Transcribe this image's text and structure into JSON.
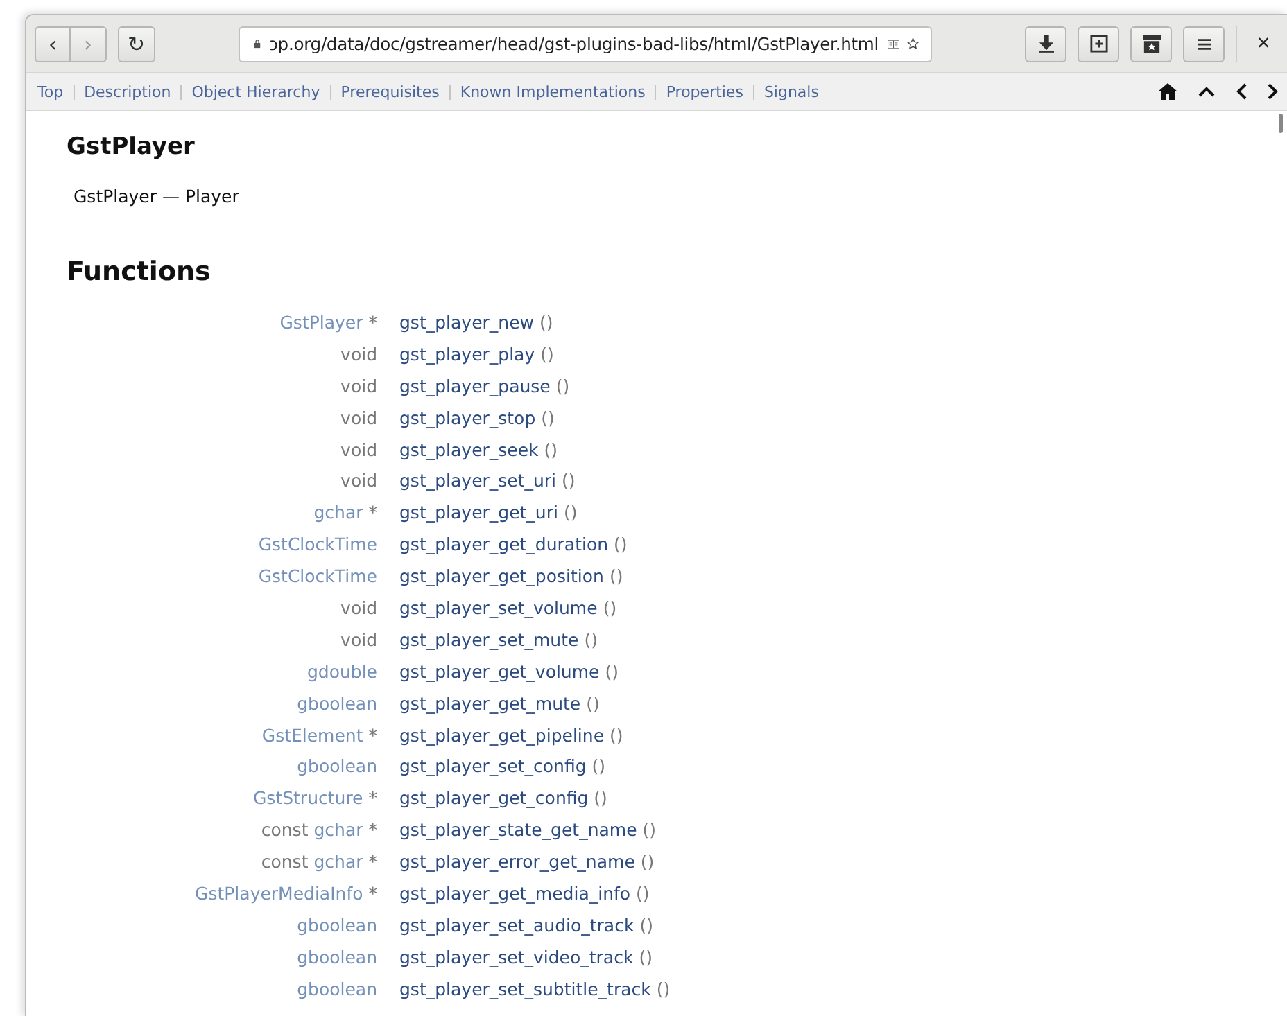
{
  "toolbar": {
    "back": "‹",
    "forward": "›",
    "reload": "↻",
    "url": "ɔp.org/data/doc/gstreamer/head/gst-plugins-bad-libs/html/GstPlayer.html",
    "close": "×"
  },
  "nav_links": [
    {
      "label": "Top"
    },
    {
      "label": "Description"
    },
    {
      "label": "Object Hierarchy"
    },
    {
      "label": "Prerequisites"
    },
    {
      "label": "Known Implementations"
    },
    {
      "label": "Properties"
    },
    {
      "label": "Signals"
    }
  ],
  "title": "GstPlayer",
  "subtitle": "GstPlayer — Player",
  "section": "Functions",
  "functions": [
    {
      "type": "GstPlayer",
      "linked": true,
      "star": "*",
      "name": "gst_player_new",
      "parens": "()"
    },
    {
      "type": "void",
      "linked": false,
      "name": "gst_player_play",
      "parens": "()"
    },
    {
      "type": "void",
      "linked": false,
      "name": "gst_player_pause",
      "parens": "()"
    },
    {
      "type": "void",
      "linked": false,
      "name": "gst_player_stop",
      "parens": "()"
    },
    {
      "type": "void",
      "linked": false,
      "name": "gst_player_seek",
      "parens": "()"
    },
    {
      "type": "void",
      "linked": false,
      "name": "gst_player_set_uri",
      "parens": "()"
    },
    {
      "type": "gchar",
      "linked": true,
      "star": "*",
      "name": "gst_player_get_uri",
      "parens": "()"
    },
    {
      "type": "GstClockTime",
      "linked": true,
      "name": "gst_player_get_duration",
      "parens": "()"
    },
    {
      "type": "GstClockTime",
      "linked": true,
      "name": "gst_player_get_position",
      "parens": "()"
    },
    {
      "type": "void",
      "linked": false,
      "name": "gst_player_set_volume",
      "parens": "()"
    },
    {
      "type": "void",
      "linked": false,
      "name": "gst_player_set_mute",
      "parens": "()"
    },
    {
      "type": "gdouble",
      "linked": true,
      "name": "gst_player_get_volume",
      "parens": "()"
    },
    {
      "type": "gboolean",
      "linked": true,
      "name": "gst_player_get_mute",
      "parens": "()"
    },
    {
      "type": "GstElement",
      "linked": true,
      "star": "*",
      "name": "gst_player_get_pipeline",
      "parens": "()"
    },
    {
      "type": "gboolean",
      "linked": true,
      "name": "gst_player_set_config",
      "parens": "()"
    },
    {
      "type": "GstStructure",
      "linked": true,
      "star": "*",
      "name": "gst_player_get_config",
      "parens": "()"
    },
    {
      "pre": "const",
      "type": "gchar",
      "linked": true,
      "star": "*",
      "name": "gst_player_state_get_name",
      "parens": "()"
    },
    {
      "pre": "const",
      "type": "gchar",
      "linked": true,
      "star": "*",
      "name": "gst_player_error_get_name",
      "parens": "()"
    },
    {
      "type": "GstPlayerMediaInfo",
      "linked": true,
      "star": "*",
      "name": "gst_player_get_media_info",
      "parens": "()"
    },
    {
      "type": "gboolean",
      "linked": true,
      "name": "gst_player_set_audio_track",
      "parens": "()"
    },
    {
      "type": "gboolean",
      "linked": true,
      "name": "gst_player_set_video_track",
      "parens": "()"
    },
    {
      "type": "gboolean",
      "linked": true,
      "name": "gst_player_set_subtitle_track",
      "parens": "()"
    }
  ]
}
